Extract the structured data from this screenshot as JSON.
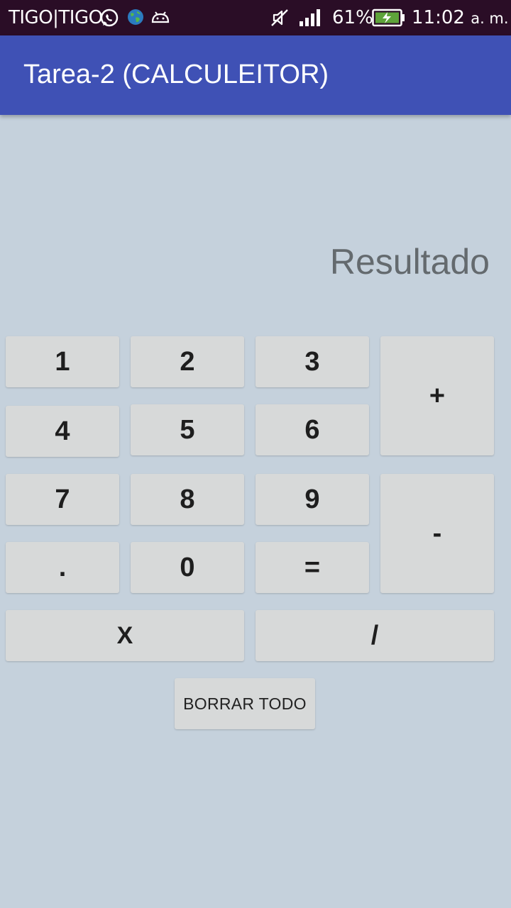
{
  "status_bar": {
    "carrier": "TIGO|TIGO",
    "battery_percent": "61%",
    "time": "11:02",
    "ampm": "a. m.",
    "icons": [
      "whatsapp-icon",
      "globe-icon",
      "android-icon",
      "mute-icon",
      "signal-icon",
      "battery-charging-icon"
    ]
  },
  "app_bar": {
    "title": "Tarea-2 (CALCULEITOR)"
  },
  "display": {
    "result": "Resultado"
  },
  "keypad": {
    "k1": "1",
    "k2": "2",
    "k3": "3",
    "plus": "+",
    "k4": "4",
    "k5": "5",
    "k6": "6",
    "k7": "7",
    "k8": "8",
    "k9": "9",
    "minus": "-",
    "dot": ".",
    "k0": "0",
    "equals": "=",
    "multiply": "X",
    "divide": "/",
    "clear_all": "BORRAR TODO"
  },
  "colors": {
    "status_bar": "#2a0d26",
    "app_bar": "#3f51b5",
    "background": "#c5d1dc",
    "button": "#d7d9d9"
  }
}
